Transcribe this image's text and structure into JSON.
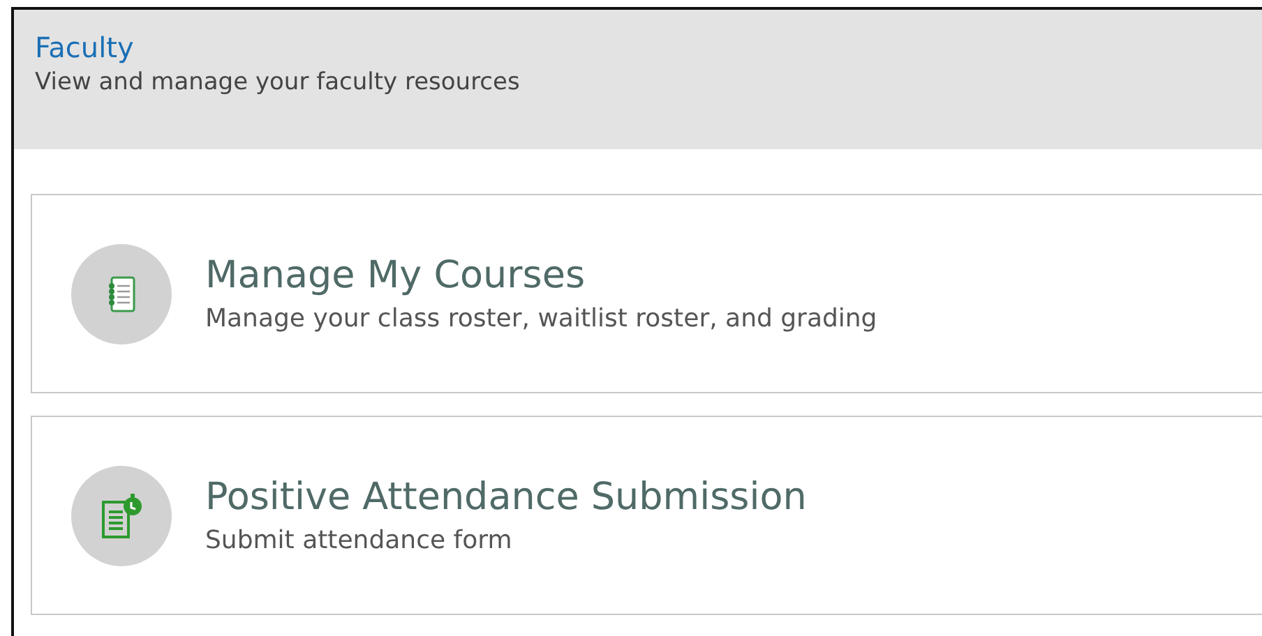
{
  "header": {
    "title": "Faculty",
    "subtitle": "View and manage your faculty resources"
  },
  "cards": [
    {
      "kind": "notebook",
      "title": "Manage My Courses",
      "description": "Manage your class roster, waitlist roster, and grading"
    },
    {
      "kind": "timed-form",
      "title": "Positive Attendance Submission",
      "description": "Submit attendance form"
    }
  ]
}
